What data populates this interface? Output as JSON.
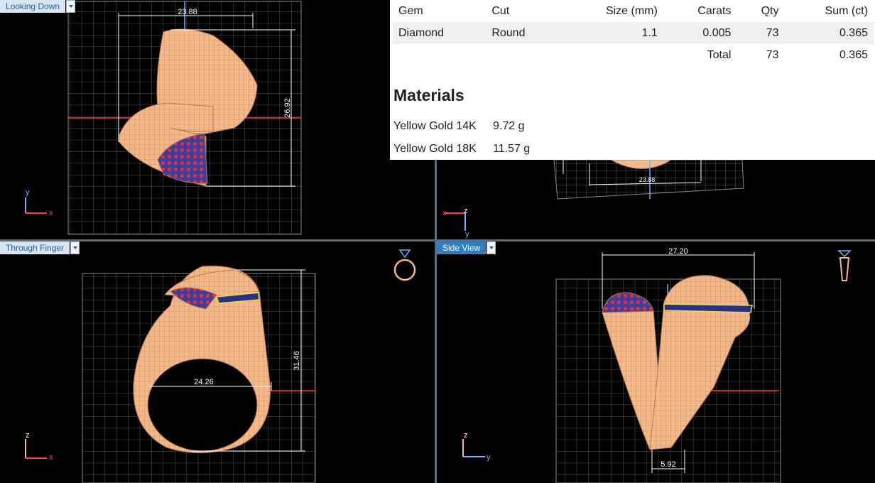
{
  "viewports": {
    "top_left": {
      "tab_label": "Looking Down",
      "dimensions": [
        "23.88",
        "26.92"
      ],
      "axes": [
        "y",
        "x"
      ]
    },
    "top_right": {
      "dimensions": [
        "23.88"
      ],
      "axes": [
        "z",
        "x",
        "y"
      ]
    },
    "bottom_left": {
      "tab_label": "Through Finger",
      "dimensions": [
        "24.26",
        "31.46"
      ],
      "axes": [
        "z",
        "x"
      ],
      "icon": "ring-icon"
    },
    "bottom_right": {
      "tab_label": "Side View",
      "dimensions": [
        "27.20",
        "5.92"
      ],
      "axes": [
        "z",
        "y"
      ],
      "icon": "ring-side-icon"
    }
  },
  "gem_table": {
    "headers": [
      "Gem",
      "Cut",
      "Size (mm)",
      "Carats",
      "Qty",
      "Sum (ct)"
    ],
    "rows": [
      {
        "gem": "Diamond",
        "cut": "Round",
        "size": "1.1",
        "carats": "0.005",
        "qty": "73",
        "sum": "0.365"
      }
    ],
    "total": {
      "label": "Total",
      "qty": "73",
      "sum": "0.365"
    }
  },
  "materials": {
    "title": "Materials",
    "items": [
      {
        "name": "Yellow Gold 14K",
        "weight": "9.72 g"
      },
      {
        "name": "Yellow Gold 18K",
        "weight": "11.57 g"
      }
    ]
  },
  "colors": {
    "metal": "#f4b98a",
    "wire": "#b8774f",
    "gem_red": "#e3303a",
    "gem_blue": "#2b2f8a",
    "dimension": "#ffffff",
    "axis_red": "#ff3b3b",
    "axis_blue": "#6fb0ff",
    "tab_active": "#2f7fc1"
  }
}
